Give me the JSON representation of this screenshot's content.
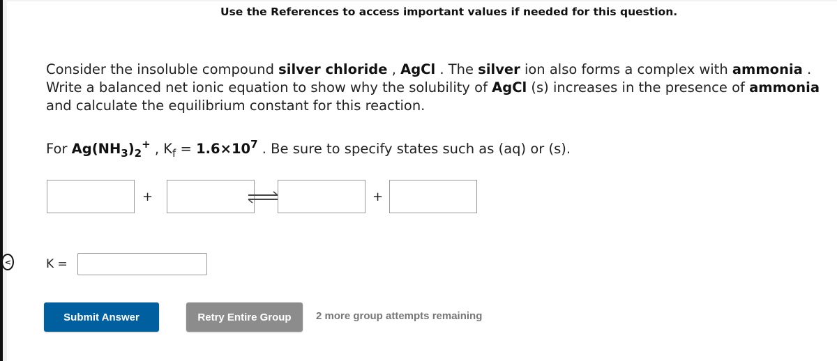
{
  "references_notice": "Use the References to access important values if needed for this question.",
  "question": {
    "line1_a": "Consider the insoluble compound ",
    "compound_name": "silver chloride",
    "line1_b": " , ",
    "compound_formula": "AgCl",
    "line1_c": " . The ",
    "ion_name": "silver",
    "line1_d": " ion also forms a complex with ",
    "ligand": "ammonia",
    "line1_e": " .",
    "line2_a": "Write a balanced net ionic equation to show why the solubility of ",
    "line2_formula": "AgCl",
    "line2_b": " (s) increases in the presence of ",
    "line2_ligand": "ammonia",
    "line3": "and calculate the equilibrium constant for this reaction."
  },
  "kf_line": {
    "prefix": "For ",
    "complex_main": "Ag(NH",
    "complex_sub1": "3",
    "complex_mid": ")",
    "complex_sub2": "2",
    "complex_charge": "+",
    "kf_sep": " , K",
    "kf_sub": "f",
    "equals": " = ",
    "kf_mantissa": "1.6×10",
    "kf_exponent": "7",
    "suffix": " . Be sure to specify states such as (aq) or (s)."
  },
  "equation": {
    "reactant1": "",
    "reactant2": "",
    "product1": "",
    "product2": "",
    "plus": "+"
  },
  "k_field": {
    "label": "K  =",
    "value": ""
  },
  "buttons": {
    "submit": "Submit Answer",
    "retry": "Retry Entire Group"
  },
  "attempts_text": "2 more group attempts remaining",
  "colors": {
    "submit_bg": "#005f9e",
    "retry_bg": "#8c8c8c"
  }
}
